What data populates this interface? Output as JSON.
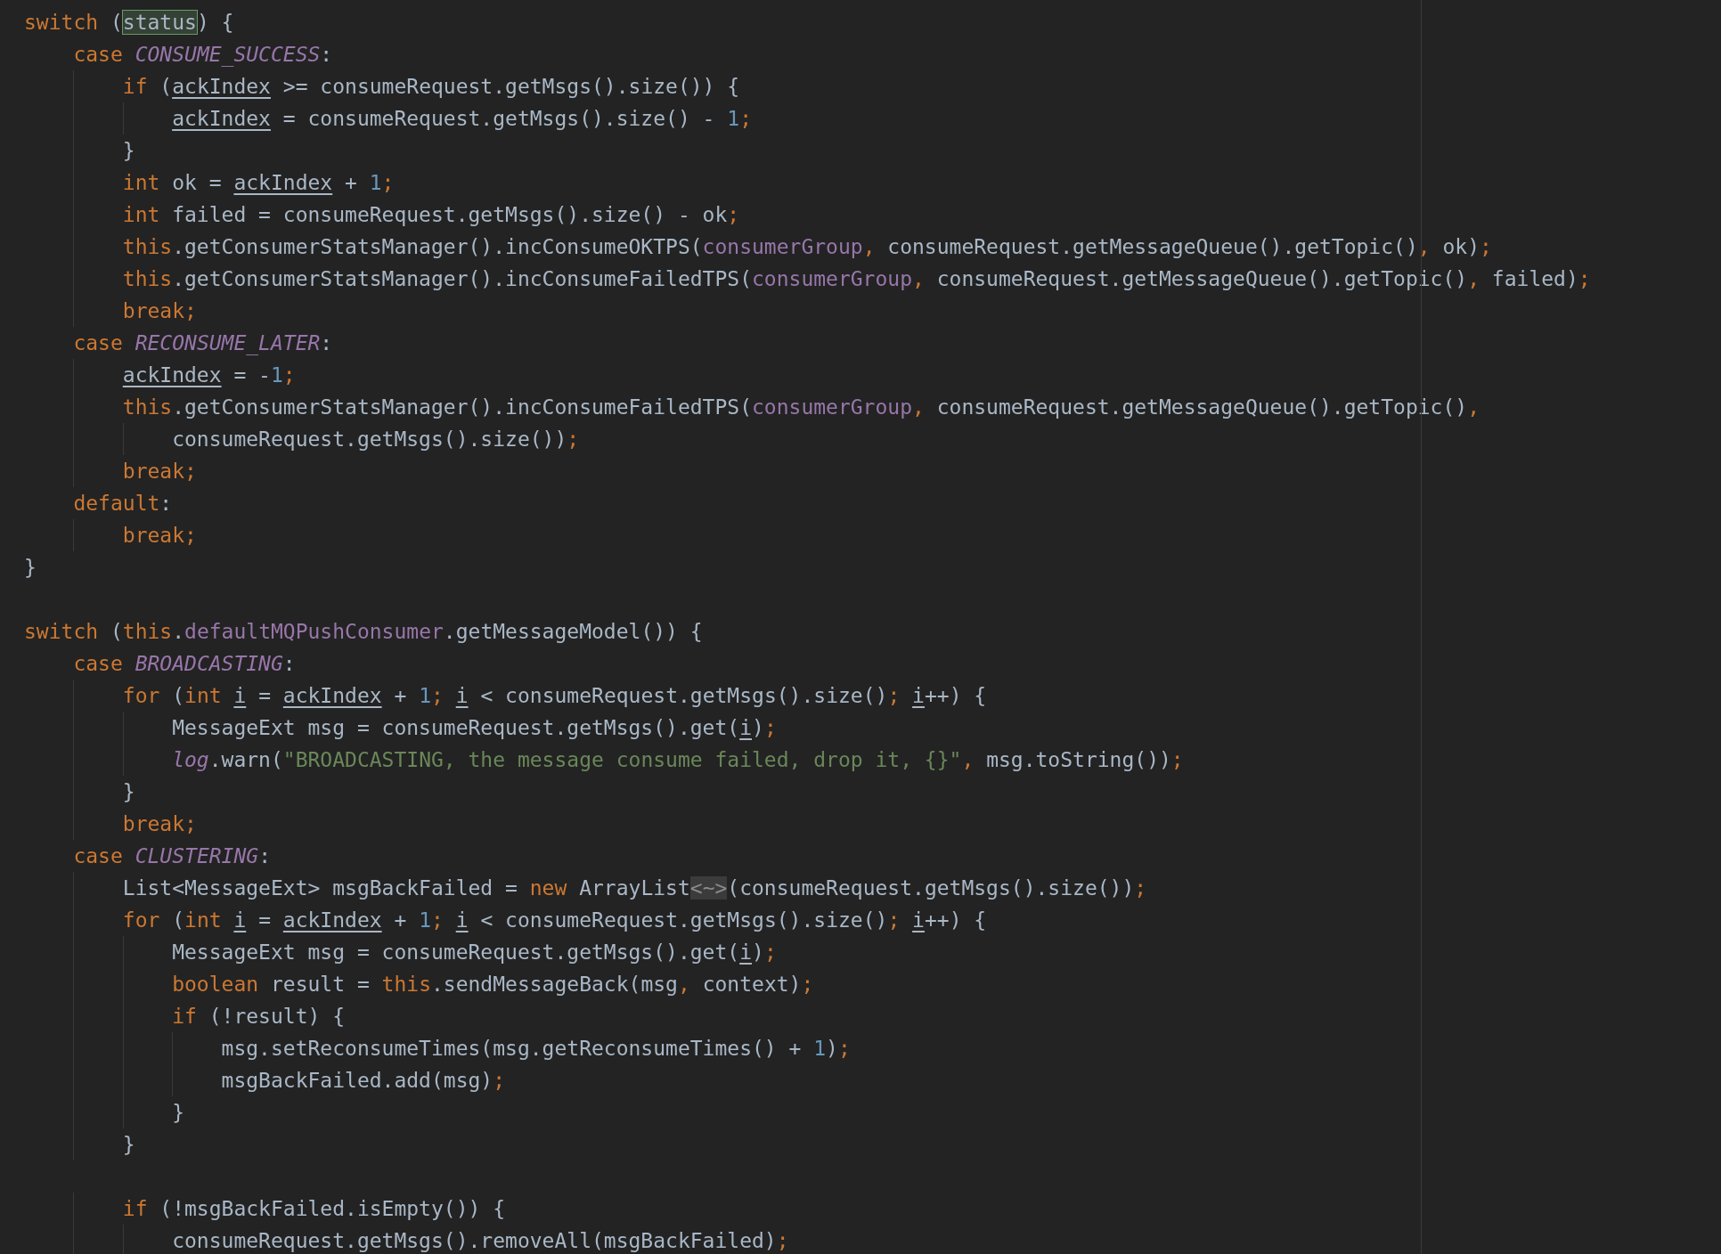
{
  "editor": {
    "blocks": [
      {
        "lines": [
          {
            "tokens": [
              {
                "text": "switch",
                "kind": "keyword"
              },
              {
                "text": " (",
                "kind": "plain"
              },
              {
                "text": "status",
                "kind": "highlight"
              },
              {
                "text": ") {",
                "kind": "plain"
              }
            ]
          },
          {
            "tokens": [
              {
                "text": "    case ",
                "kind": "keyword"
              },
              {
                "text": "CONSUME_SUCCESS",
                "kind": "constant"
              },
              {
                "text": ":",
                "kind": "plain"
              }
            ]
          },
          {
            "tokens": [
              {
                "text": "        if",
                "kind": "keyword"
              },
              {
                "text": " (",
                "kind": "plain"
              },
              {
                "text": "ackIndex",
                "kind": "local"
              },
              {
                "text": " >= consumeRequest.getMsgs().size()) {",
                "kind": "plain"
              }
            ]
          },
          {
            "tokens": [
              {
                "text": "            ackIndex",
                "kind": "local"
              },
              {
                "text": " = consumeRequest.getMsgs().size() - ",
                "kind": "plain"
              },
              {
                "text": "1",
                "kind": "number"
              },
              {
                "text": ";",
                "kind": "punct"
              }
            ]
          },
          {
            "tokens": [
              {
                "text": "        }",
                "kind": "plain"
              }
            ]
          },
          {
            "tokens": [
              {
                "text": "        int",
                "kind": "keyword"
              },
              {
                "text": " ok = ",
                "kind": "plain"
              },
              {
                "text": "ackIndex",
                "kind": "local"
              },
              {
                "text": " + ",
                "kind": "plain"
              },
              {
                "text": "1",
                "kind": "number"
              },
              {
                "text": ";",
                "kind": "punct"
              }
            ]
          },
          {
            "tokens": [
              {
                "text": "        int",
                "kind": "keyword"
              },
              {
                "text": " failed = consumeRequest.getMsgs().size() - ok",
                "kind": "plain"
              },
              {
                "text": ";",
                "kind": "punct"
              }
            ]
          },
          {
            "tokens": [
              {
                "text": "        this",
                "kind": "keyword"
              },
              {
                "text": ".getConsumerStatsManager().incConsumeOKTPS(",
                "kind": "plain"
              },
              {
                "text": "consumerGroup",
                "kind": "field"
              },
              {
                "text": ",",
                "kind": "punct"
              },
              {
                "text": " consumeRequest.getMessageQueue().getTopic()",
                "kind": "plain"
              },
              {
                "text": ",",
                "kind": "punct"
              },
              {
                "text": " ok)",
                "kind": "plain"
              },
              {
                "text": ";",
                "kind": "punct"
              }
            ]
          },
          {
            "tokens": [
              {
                "text": "        this",
                "kind": "keyword"
              },
              {
                "text": ".getConsumerStatsManager().incConsumeFailedTPS(",
                "kind": "plain"
              },
              {
                "text": "consumerGroup",
                "kind": "field"
              },
              {
                "text": ",",
                "kind": "punct"
              },
              {
                "text": " consumeRequest.getMessageQueue().getTopic()",
                "kind": "plain"
              },
              {
                "text": ",",
                "kind": "punct"
              },
              {
                "text": " failed)",
                "kind": "plain"
              },
              {
                "text": ";",
                "kind": "punct"
              }
            ]
          },
          {
            "tokens": [
              {
                "text": "        break;",
                "kind": "keyword"
              }
            ]
          },
          {
            "tokens": [
              {
                "text": "    case ",
                "kind": "keyword"
              },
              {
                "text": "RECONSUME_LATER",
                "kind": "constant"
              },
              {
                "text": ":",
                "kind": "plain"
              }
            ]
          },
          {
            "tokens": [
              {
                "text": "        ackIndex",
                "kind": "local"
              },
              {
                "text": " = -",
                "kind": "plain"
              },
              {
                "text": "1",
                "kind": "number"
              },
              {
                "text": ";",
                "kind": "punct"
              }
            ]
          },
          {
            "tokens": [
              {
                "text": "        this",
                "kind": "keyword"
              },
              {
                "text": ".getConsumerStatsManager().incConsumeFailedTPS(",
                "kind": "plain"
              },
              {
                "text": "consumerGroup",
                "kind": "field"
              },
              {
                "text": ",",
                "kind": "punct"
              },
              {
                "text": " consumeRequest.getMessageQueue().getTopic()",
                "kind": "plain"
              },
              {
                "text": ",",
                "kind": "punct"
              }
            ]
          },
          {
            "tokens": [
              {
                "text": "            consumeRequest.getMsgs().size())",
                "kind": "plain"
              },
              {
                "text": ";",
                "kind": "punct"
              }
            ]
          },
          {
            "tokens": [
              {
                "text": "        break;",
                "kind": "keyword"
              }
            ]
          },
          {
            "tokens": [
              {
                "text": "    default",
                "kind": "keyword"
              },
              {
                "text": ":",
                "kind": "plain"
              }
            ]
          },
          {
            "tokens": [
              {
                "text": "        break;",
                "kind": "keyword"
              }
            ]
          },
          {
            "tokens": [
              {
                "text": "}",
                "kind": "plain"
              }
            ]
          }
        ]
      },
      {
        "lines": [
          {
            "tokens": [
              {
                "text": "switch",
                "kind": "keyword"
              },
              {
                "text": " (",
                "kind": "plain"
              },
              {
                "text": "this",
                "kind": "keyword"
              },
              {
                "text": ".",
                "kind": "plain"
              },
              {
                "text": "defaultMQPushConsumer",
                "kind": "field"
              },
              {
                "text": ".getMessageModel()) {",
                "kind": "plain"
              }
            ]
          },
          {
            "tokens": [
              {
                "text": "    case ",
                "kind": "keyword"
              },
              {
                "text": "BROADCASTING",
                "kind": "constant"
              },
              {
                "text": ":",
                "kind": "plain"
              }
            ]
          },
          {
            "tokens": [
              {
                "text": "        for",
                "kind": "keyword"
              },
              {
                "text": " (",
                "kind": "plain"
              },
              {
                "text": "int ",
                "kind": "keyword"
              },
              {
                "text": "i",
                "kind": "local"
              },
              {
                "text": " = ",
                "kind": "plain"
              },
              {
                "text": "ackIndex",
                "kind": "local"
              },
              {
                "text": " + ",
                "kind": "plain"
              },
              {
                "text": "1",
                "kind": "number"
              },
              {
                "text": "; ",
                "kind": "punct"
              },
              {
                "text": "i",
                "kind": "local"
              },
              {
                "text": " < consumeRequest.getMsgs().size()",
                "kind": "plain"
              },
              {
                "text": "; ",
                "kind": "punct"
              },
              {
                "text": "i",
                "kind": "local"
              },
              {
                "text": "++) {",
                "kind": "plain"
              }
            ]
          },
          {
            "tokens": [
              {
                "text": "            MessageExt msg = consumeRequest.getMsgs().get(",
                "kind": "plain"
              },
              {
                "text": "i",
                "kind": "local"
              },
              {
                "text": ")",
                "kind": "plain"
              },
              {
                "text": ";",
                "kind": "punct"
              }
            ]
          },
          {
            "tokens": [
              {
                "text": "            log",
                "kind": "static"
              },
              {
                "text": ".warn(",
                "kind": "plain"
              },
              {
                "text": "\"BROADCASTING, the message consume failed, drop it, {}\"",
                "kind": "string"
              },
              {
                "text": ",",
                "kind": "punct"
              },
              {
                "text": " msg.toString())",
                "kind": "plain"
              },
              {
                "text": ";",
                "kind": "punct"
              }
            ]
          },
          {
            "tokens": [
              {
                "text": "        }",
                "kind": "plain"
              }
            ]
          },
          {
            "tokens": [
              {
                "text": "        break;",
                "kind": "keyword"
              }
            ]
          },
          {
            "tokens": [
              {
                "text": "    case ",
                "kind": "keyword"
              },
              {
                "text": "CLUSTERING",
                "kind": "constant"
              },
              {
                "text": ":",
                "kind": "plain"
              }
            ]
          },
          {
            "tokens": [
              {
                "text": "        List<MessageExt> msgBackFailed = ",
                "kind": "plain"
              },
              {
                "text": "new",
                "kind": "keyword"
              },
              {
                "text": " ArrayList",
                "kind": "plain"
              },
              {
                "text": "<~>",
                "kind": "fold"
              },
              {
                "text": "(consumeRequest.getMsgs().size())",
                "kind": "plain"
              },
              {
                "text": ";",
                "kind": "punct"
              }
            ]
          },
          {
            "tokens": [
              {
                "text": "        for",
                "kind": "keyword"
              },
              {
                "text": " (",
                "kind": "plain"
              },
              {
                "text": "int ",
                "kind": "keyword"
              },
              {
                "text": "i",
                "kind": "local"
              },
              {
                "text": " = ",
                "kind": "plain"
              },
              {
                "text": "ackIndex",
                "kind": "local"
              },
              {
                "text": " + ",
                "kind": "plain"
              },
              {
                "text": "1",
                "kind": "number"
              },
              {
                "text": "; ",
                "kind": "punct"
              },
              {
                "text": "i",
                "kind": "local"
              },
              {
                "text": " < consumeRequest.getMsgs().size()",
                "kind": "plain"
              },
              {
                "text": "; ",
                "kind": "punct"
              },
              {
                "text": "i",
                "kind": "local"
              },
              {
                "text": "++) {",
                "kind": "plain"
              }
            ]
          },
          {
            "tokens": [
              {
                "text": "            MessageExt msg = consumeRequest.getMsgs().get(",
                "kind": "plain"
              },
              {
                "text": "i",
                "kind": "local"
              },
              {
                "text": ")",
                "kind": "plain"
              },
              {
                "text": ";",
                "kind": "punct"
              }
            ]
          },
          {
            "tokens": [
              {
                "text": "            boolean",
                "kind": "keyword"
              },
              {
                "text": " result = ",
                "kind": "plain"
              },
              {
                "text": "this",
                "kind": "keyword"
              },
              {
                "text": ".sendMessageBack(msg",
                "kind": "plain"
              },
              {
                "text": ",",
                "kind": "punct"
              },
              {
                "text": " context)",
                "kind": "plain"
              },
              {
                "text": ";",
                "kind": "punct"
              }
            ]
          },
          {
            "tokens": [
              {
                "text": "            if",
                "kind": "keyword"
              },
              {
                "text": " (!result) {",
                "kind": "plain"
              }
            ]
          },
          {
            "tokens": [
              {
                "text": "                msg.setReconsumeTimes(msg.getReconsumeTimes() + ",
                "kind": "plain"
              },
              {
                "text": "1",
                "kind": "number"
              },
              {
                "text": ")",
                "kind": "plain"
              },
              {
                "text": ";",
                "kind": "punct"
              }
            ]
          },
          {
            "tokens": [
              {
                "text": "                msgBackFailed.add(msg)",
                "kind": "plain"
              },
              {
                "text": ";",
                "kind": "punct"
              }
            ]
          },
          {
            "tokens": [
              {
                "text": "            }",
                "kind": "plain"
              }
            ]
          },
          {
            "tokens": [
              {
                "text": "        }",
                "kind": "plain"
              }
            ]
          }
        ]
      },
      {
        "lines": [
          {
            "tokens": [
              {
                "text": "        if",
                "kind": "keyword"
              },
              {
                "text": " (!msgBackFailed.isEmpty()) {",
                "kind": "plain"
              }
            ]
          },
          {
            "tokens": [
              {
                "text": "            consumeRequest.getMsgs().removeAll(msgBackFailed)",
                "kind": "plain"
              },
              {
                "text": ";",
                "kind": "punct"
              }
            ]
          }
        ]
      }
    ]
  }
}
